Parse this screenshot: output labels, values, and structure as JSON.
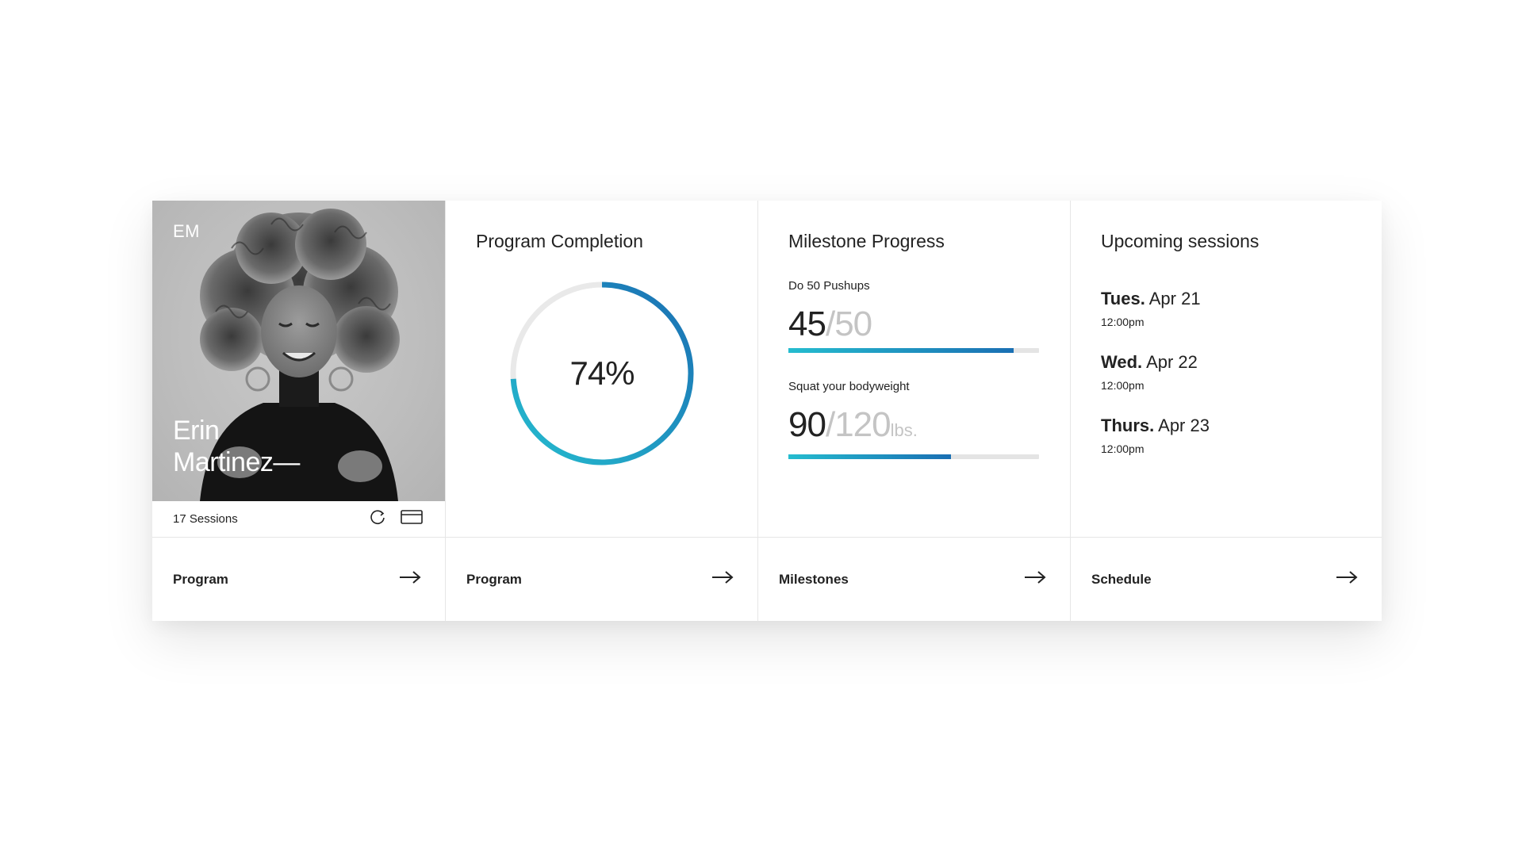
{
  "profile": {
    "initials": "EM",
    "name_first": "Erin",
    "name_last": "Martinez—",
    "sessions_label": "17 Sessions",
    "icons": [
      "refresh-icon",
      "card-icon"
    ]
  },
  "completion": {
    "title": "Program Completion",
    "percent": 74,
    "percent_label": "74%",
    "colors": {
      "start": "#25bccf",
      "end": "#1a6fb3",
      "track": "#e9e9e9"
    }
  },
  "milestones": {
    "title": "Milestone Progress",
    "items": [
      {
        "label": "Do 50 Pushups",
        "current": "45",
        "separator": "/",
        "target": "50",
        "unit": "",
        "fraction": 0.9
      },
      {
        "label": "Squat your bodyweight",
        "current": "90",
        "separator": "/",
        "target": "120",
        "unit": "lbs.",
        "fraction": 0.65
      }
    ]
  },
  "sessions": {
    "title": "Upcoming sessions",
    "items": [
      {
        "day": "Tues.",
        "date": "Apr 21",
        "time": "12:00pm"
      },
      {
        "day": "Wed.",
        "date": "Apr 22",
        "time": "12:00pm"
      },
      {
        "day": "Thurs.",
        "date": "Apr 23",
        "time": "12:00pm"
      }
    ]
  },
  "links": [
    {
      "label": "Program",
      "icon": "arrow-right-icon"
    },
    {
      "label": "Program",
      "icon": "arrow-right-icon"
    },
    {
      "label": "Milestones",
      "icon": "arrow-right-icon"
    },
    {
      "label": "Schedule",
      "icon": "arrow-right-icon"
    }
  ]
}
